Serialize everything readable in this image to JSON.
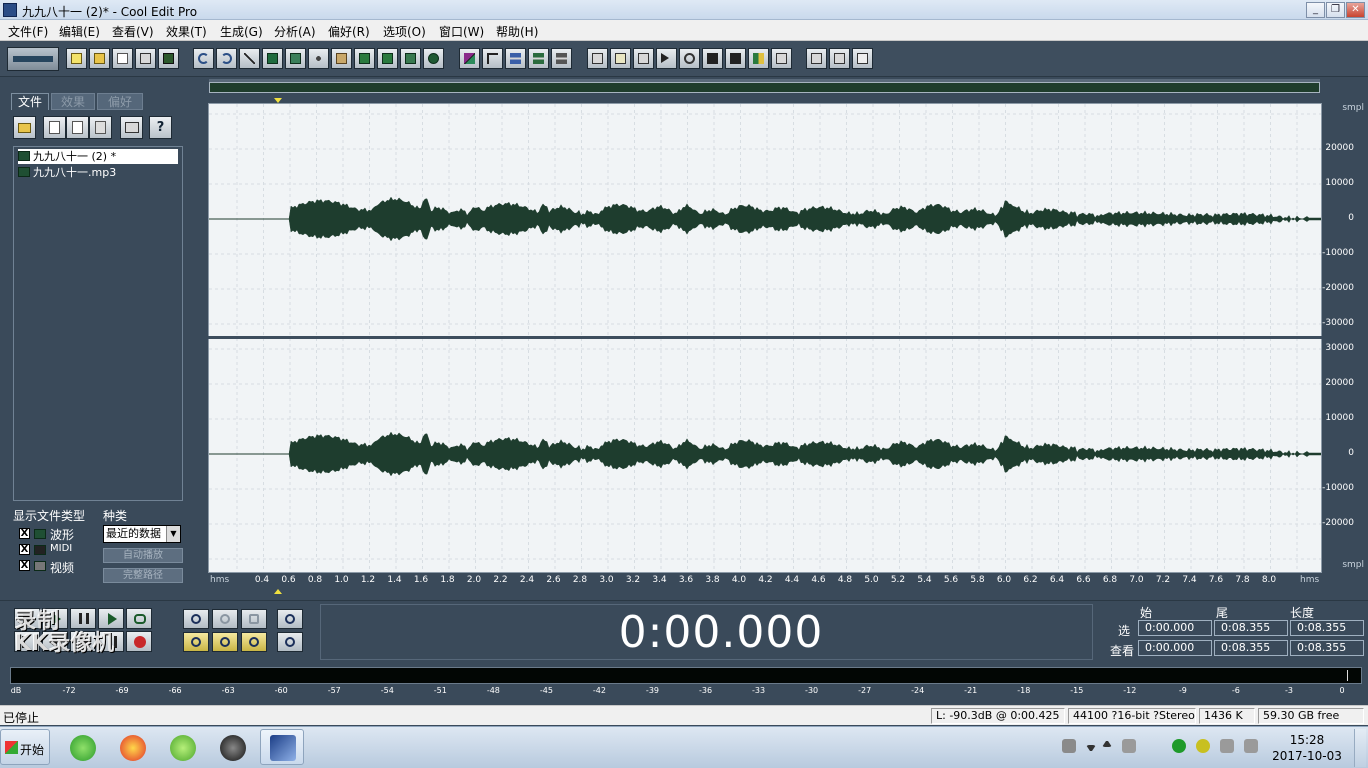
{
  "window": {
    "title": "九九八十一 (2)* - Cool Edit Pro",
    "minimize_glyph": "_",
    "maximize_glyph": "❐",
    "close_glyph": "✕"
  },
  "menu": [
    "文件(F)",
    "编辑(E)",
    "查看(V)",
    "效果(T)",
    "生成(G)",
    "分析(A)",
    "偏好(R)",
    "选项(O)",
    "窗口(W)",
    "帮助(H)"
  ],
  "left_panel": {
    "tabs": [
      "文件",
      "效果",
      "偏好"
    ],
    "files": [
      "九九八十一 (2) *",
      "九九八十一.mp3"
    ],
    "show_types_label": "显示文件类型",
    "types": [
      "波形",
      "MIDI",
      "视频"
    ],
    "checked_glyph": "X",
    "category_label": "种类",
    "category_value": "最近的数据",
    "auto_play_label": "自动播放",
    "full_path_label": "完整路径",
    "help_glyph": "?"
  },
  "waveform": {
    "y_unit": "smpl",
    "top_channel_y_labels": [
      "20000",
      "10000",
      "0",
      "-10000",
      "-20000",
      "-30000"
    ],
    "bottom_channel_y_labels": [
      "30000",
      "20000",
      "10000",
      "0",
      "-10000",
      "-20000"
    ],
    "x_unit": "hms",
    "x_labels": [
      "0.4",
      "0.6",
      "0.8",
      "1.0",
      "1.2",
      "1.4",
      "1.6",
      "1.8",
      "2.0",
      "2.2",
      "2.4",
      "2.6",
      "2.8",
      "3.0",
      "3.2",
      "3.4",
      "3.6",
      "3.8",
      "4.0",
      "4.2",
      "4.4",
      "4.6",
      "4.8",
      "5.0",
      "5.2",
      "5.4",
      "5.6",
      "5.8",
      "6.0",
      "6.2",
      "6.4",
      "6.6",
      "6.8",
      "7.0",
      "7.2",
      "7.4",
      "7.6",
      "7.8",
      "8.0"
    ],
    "wave_color": "#1e3d2e",
    "background_color": "#f1f4f6"
  },
  "transport": {
    "watermark_line1": "录制",
    "watermark_line2": "KK录像机",
    "time": "0:00.000"
  },
  "selection": {
    "headers": [
      "始",
      "尾",
      "长度"
    ],
    "rows": [
      {
        "label": "选",
        "begin": "0:00.000",
        "end": "0:08.355",
        "length": "0:08.355"
      },
      {
        "label": "查看",
        "begin": "0:00.000",
        "end": "0:08.355",
        "length": "0:08.355"
      }
    ]
  },
  "meter": {
    "labels": [
      "dB",
      "-72",
      "-69",
      "-66",
      "-63",
      "-60",
      "-57",
      "-54",
      "-51",
      "-48",
      "-45",
      "-42",
      "-39",
      "-36",
      "-33",
      "-30",
      "-27",
      "-24",
      "-21",
      "-18",
      "-15",
      "-12",
      "-9",
      "-6",
      "-3",
      "0"
    ]
  },
  "status": {
    "state": "已停止",
    "level": "L: -90.3dB @  0:00.425",
    "format": "44100 ?16-bit ?Stereo",
    "size": "1436 K",
    "free": "59.30 GB free"
  },
  "taskbar": {
    "start_label": "开始",
    "time": "15:28",
    "date": "2017-10-03"
  }
}
